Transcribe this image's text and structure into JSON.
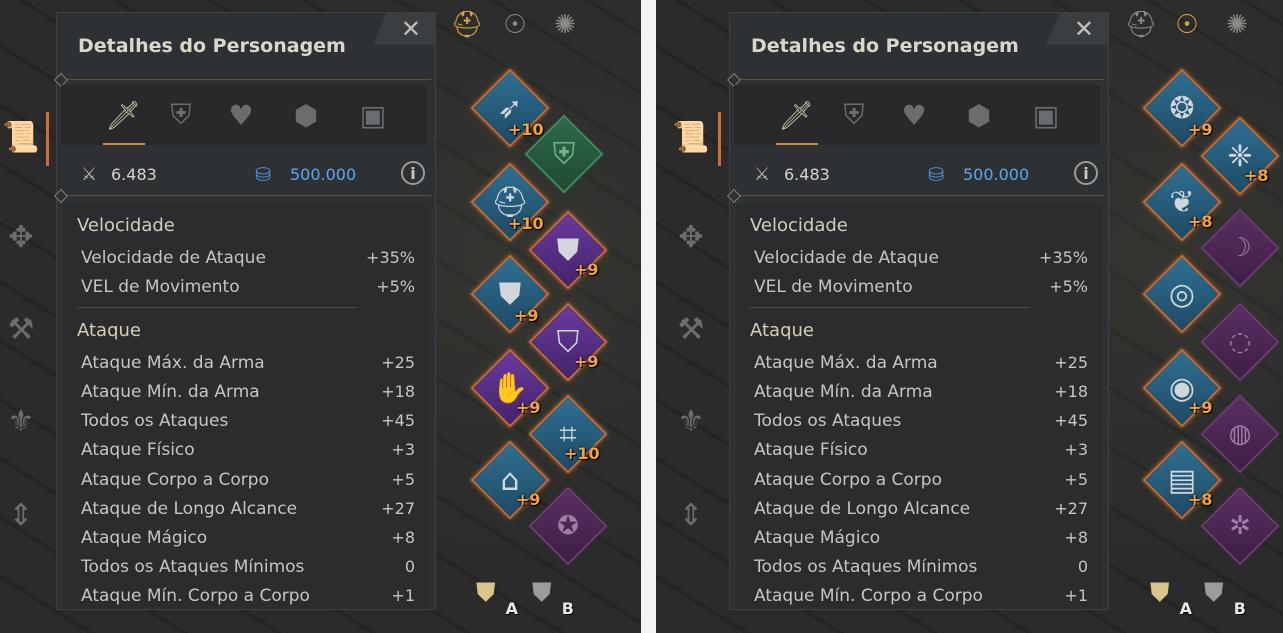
{
  "panel": {
    "title": "Detalhes do Personagem",
    "close_glyph": "✕",
    "tabs": [
      "sword-icon",
      "shield-icon",
      "heart-icon",
      "gear-icon",
      "chat-icon"
    ],
    "combat_power": "6.483",
    "silver": "500.000",
    "info_glyph": "i",
    "sections": [
      {
        "title": "Velocidade",
        "rows": [
          {
            "label": "Velocidade de Ataque",
            "value": "+35%"
          },
          {
            "label": "VEL de Movimento",
            "value": "+5%"
          }
        ]
      },
      {
        "title": "Ataque",
        "rows": [
          {
            "label": "Ataque Máx. da Arma",
            "value": "+25"
          },
          {
            "label": "Ataque Mín. da Arma",
            "value": "+18"
          },
          {
            "label": "Todos os Ataques",
            "value": "+45"
          },
          {
            "label": "Ataque Físico",
            "value": "+3"
          },
          {
            "label": "Ataque Corpo a Corpo",
            "value": "+5"
          },
          {
            "label": "Ataque de Longo Alcance",
            "value": "+27"
          },
          {
            "label": "Ataque Mágico",
            "value": "+8"
          },
          {
            "label": "Todos os Ataques Mínimos",
            "value": "0"
          },
          {
            "label": "Ataque Mín. Corpo a Corpo",
            "value": "+1"
          }
        ]
      }
    ]
  },
  "left_view": {
    "enhancements": [
      "+10",
      "+10",
      "+9",
      "+9",
      "+9",
      "+9",
      "+10",
      "+9"
    ]
  },
  "right_view": {
    "enhancements": [
      "+9",
      "+8",
      "+8",
      "+9",
      "+8"
    ]
  },
  "presets": {
    "a": "A",
    "b": "B"
  },
  "colors": {
    "accent": "#d76a2c",
    "silver": "#5ea6ea",
    "enhance": "#f0a045"
  }
}
